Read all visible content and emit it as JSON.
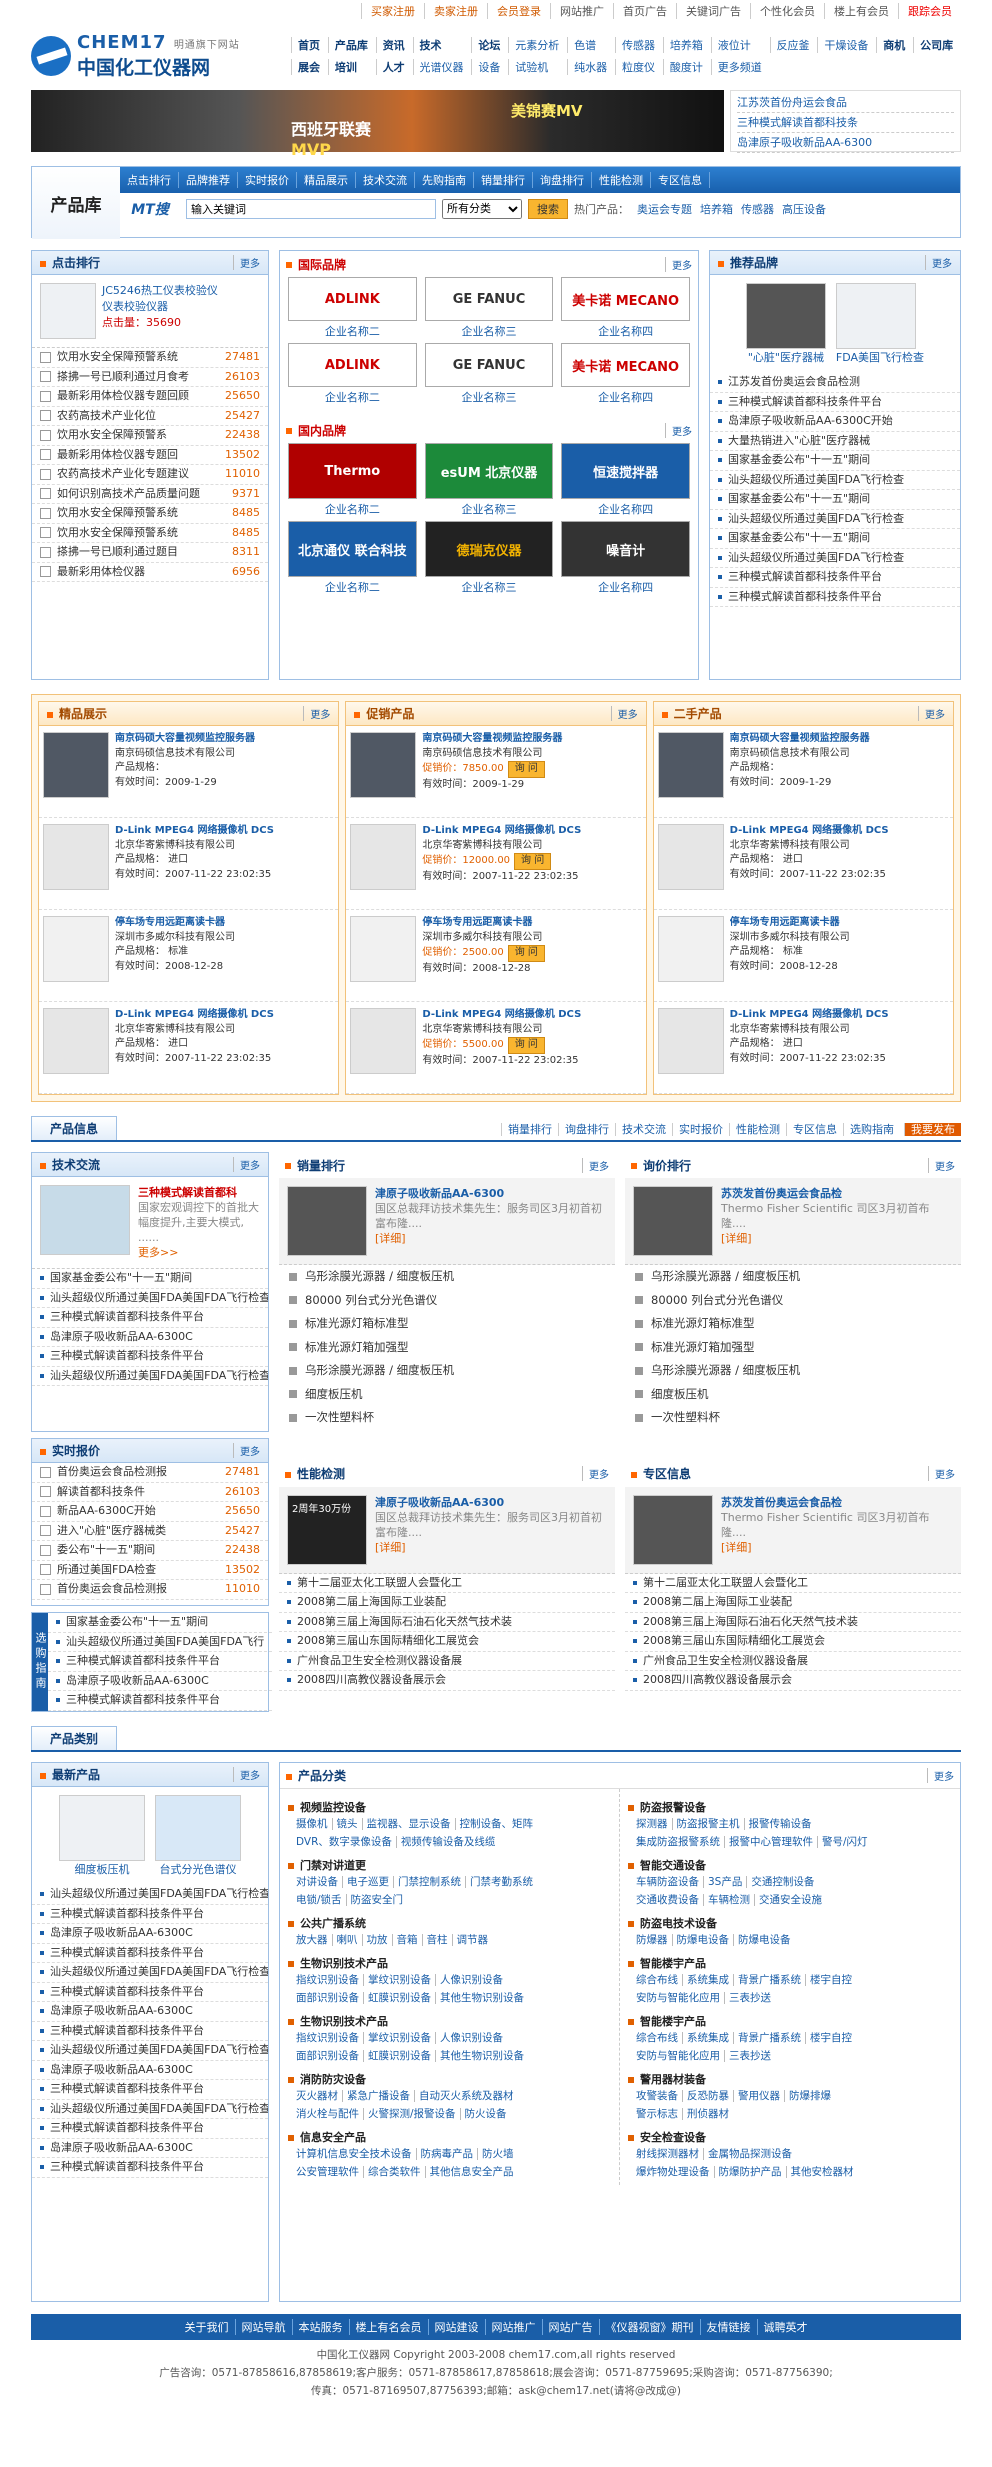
{
  "topbar": {
    "items": [
      "买家注册",
      "卖家注册",
      "会员登录",
      "网站推广",
      "首页广告",
      "关键词广告",
      "个性化会员",
      "楼上有会员",
      "跟踪会员"
    ]
  },
  "logo": {
    "brand": "CHEM17",
    "tag": "明通旗下网站",
    "name": "中国化工仪器网"
  },
  "nav": [
    "首页",
    "产品库",
    "资讯",
    "技术",
    "论坛",
    "元素分析",
    "色谱",
    "传感器",
    "培养箱",
    "液位计",
    "反应釜",
    "干燥设备",
    "商机",
    "公司库",
    "展会",
    "培训",
    "人才",
    "光谱仪器",
    "设备",
    "试验机",
    "纯水器",
    "粒度仪",
    "酸度计",
    "更多频道"
  ],
  "banner": {
    "text1": "西班牙联赛",
    "text1b": "MVP",
    "text2": "美锦赛MV"
  },
  "banner_news": [
    "江苏茨首份舟运会食品",
    "三种模式解读首都科技条",
    "岛津原子吸收新品AA-6300"
  ],
  "prodlib": {
    "title": "产品库",
    "bar": [
      "点击排行",
      "品牌推荐",
      "实时报价",
      "精品展示",
      "技术交流",
      "先购指南",
      "销量排行",
      "询盘排行",
      "性能检测",
      "专区信息"
    ],
    "mt": "MT搜",
    "search_value": "输入关键词",
    "select": "所有分类",
    "btn": "搜索",
    "hot_label": "热门产品：",
    "hot": [
      "奥运会专题",
      "培养箱",
      "传感器",
      "高压设备"
    ]
  },
  "click_rank": {
    "title": "点击排行",
    "more": "更多",
    "top": {
      "name": "JC5246热工仪表校验仪",
      "name2": "仪表校验仪器",
      "clicks": "点击量：35690"
    },
    "items": [
      [
        "饮用水安全保障预警系统",
        "27481"
      ],
      [
        "搽拂一号已顺利通过月食考",
        "26103"
      ],
      [
        "最新彩用体检仪器专题回顾",
        "25650"
      ],
      [
        "农药高技术产业化位",
        "25427"
      ],
      [
        "饮用水安全保障预警系",
        "22438"
      ],
      [
        "最新彩用体检仪器专题回",
        "13502"
      ],
      [
        "农药高技术产业化专题建议",
        "11010"
      ],
      [
        "如何识别高技术产品质量问题",
        "9371"
      ],
      [
        "饮用水安全保障预警系统",
        "8485"
      ],
      [
        "饮用水安全保障预警系统",
        "8485"
      ],
      [
        "搽拂一号已顺利通过题目",
        "8311"
      ],
      [
        "最新彩用体检仪器",
        "6956"
      ]
    ]
  },
  "intl_brands": {
    "title": "国际品牌",
    "more": "更多",
    "items": [
      {
        "logo": "ADLINK",
        "cap": "企业名称二"
      },
      {
        "logo": "GE FANUC",
        "cap": "企业名称三"
      },
      {
        "logo": "美卡诺 MECANO",
        "cap": "企业名称四"
      },
      {
        "logo": "ADLINK",
        "cap": "企业名称二"
      },
      {
        "logo": "GE FANUC",
        "cap": "企业名称三"
      },
      {
        "logo": "美卡诺 MECANO",
        "cap": "企业名称四"
      }
    ]
  },
  "dom_brands": {
    "title": "国内品牌",
    "more": "更多",
    "items": [
      {
        "logo": "Thermo",
        "cap": "企业名称二"
      },
      {
        "logo": "esUM 北京仪器",
        "cap": "企业名称三"
      },
      {
        "logo": "恒速搅拌器",
        "cap": "企业名称四"
      },
      {
        "logo": "北京通仪 联合科技",
        "cap": "企业名称二"
      },
      {
        "logo": "德瑞克仪器",
        "cap": "企业名称三"
      },
      {
        "logo": "噪音计",
        "cap": "企业名称四"
      }
    ]
  },
  "recommend": {
    "title": "推荐品牌",
    "more": "更多",
    "imgs": [
      "\"心脏\"医疗器械",
      "FDA美国飞行检查"
    ],
    "items": [
      "江苏发首份奥运会食品检测",
      "三种模式解读首都科技条件平台",
      "岛津原子吸收新品AA-6300C开始",
      "大量热销进入\"心脏\"医疗器械",
      "国家基金委公布\"十一五\"期间",
      "汕头超级仪所通过美国FDA飞行检查",
      "国家基金委公布\"十一五\"期间",
      "汕头超级仪所通过美国FDA飞行检查",
      "国家基金委公布\"十一五\"期间",
      "汕头超级仪所通过美国FDA飞行检查",
      "三种模式解读首都科技条件平台",
      "三种模式解读首都科技条件平台"
    ]
  },
  "showcase": {
    "title": "精品展示",
    "more": "更多",
    "items": [
      {
        "name": "南京码硕大容量视频监控服务器",
        "co": "南京码硕信息技术有限公司",
        "l2": "产品规格：",
        "time": "有效时间：2009-1-29"
      },
      {
        "name": "D-Link MPEG4 网络摄像机 DCS",
        "co": "北京华寄紫博科技有限公司",
        "l2": "产品规格： 进口",
        "time": "有效时间：2007-11-22 23:02:35"
      },
      {
        "name": "停车场专用远距离读卡器",
        "co": "深圳市多威尔科技有限公司",
        "l2": "产品规格： 标准",
        "time": "有效时间：2008-12-28"
      },
      {
        "name": "D-Link MPEG4 网络摄像机 DCS",
        "co": "北京华寄紫博科技有限公司",
        "l2": "产品规格： 进口",
        "time": "有效时间：2007-11-22 23:02:35"
      }
    ]
  },
  "promo": {
    "title": "促销产品",
    "more": "更多",
    "ask": "询 问",
    "items": [
      {
        "name": "南京码硕大容量视频监控服务器",
        "co": "南京码硕信息技术有限公司",
        "price": "促销价：7850.00",
        "time": "有效时间：2009-1-29"
      },
      {
        "name": "D-Link MPEG4 网络摄像机 DCS",
        "co": "北京华寄紫博科技有限公司",
        "price": "促销价：12000.00",
        "time": "有效时间：2007-11-22 23:02:35"
      },
      {
        "name": "停车场专用远距离读卡器",
        "co": "深圳市多威尔科技有限公司",
        "price": "促销价：2500.00",
        "time": "有效时间：2008-12-28"
      },
      {
        "name": "D-Link MPEG4 网络摄像机 DCS",
        "co": "北京华寄紫博科技有限公司",
        "price": "促销价：5500.00",
        "time": "有效时间：2007-11-22 23:02:35"
      }
    ]
  },
  "second": {
    "title": "二手产品",
    "more": "更多",
    "items": [
      {
        "name": "南京码硕大容量视频监控服务器",
        "co": "南京码硕信息技术有限公司",
        "l2": "产品规格：",
        "time": "有效时间：2009-1-29"
      },
      {
        "name": "D-Link MPEG4 网络摄像机 DCS",
        "co": "北京华寄紫博科技有限公司",
        "l2": "产品规格： 进口",
        "time": "有效时间：2007-11-22 23:02:35"
      },
      {
        "name": "停车场专用远距离读卡器",
        "co": "深圳市多威尔科技有限公司",
        "l2": "产品规格： 标准",
        "time": "有效时间：2008-12-28"
      },
      {
        "name": "D-Link MPEG4 网络摄像机 DCS",
        "co": "北京华寄紫博科技有限公司",
        "l2": "产品规格： 进口",
        "time": "有效时间：2007-11-22 23:02:35"
      }
    ]
  },
  "info_tab": {
    "tab": "产品信息",
    "links": [
      "销量排行",
      "询盘排行",
      "技术交流",
      "实时报价",
      "性能检测",
      "专区信息",
      "选购指南"
    ],
    "pub": "我要发布"
  },
  "tech": {
    "title": "技术交流",
    "more": "更多",
    "feat_title": "三种模式解读首都科",
    "feat_desc": "国家宏观调控下的首批大幅度提升,主要大模式, ......",
    "feat_more": "更多>>",
    "items": [
      "国家基金委公布\"十一五\"期间",
      "汕头超级仪所通过美国FDA美国FDA飞行检查",
      "三种模式解读首都科技条件平台",
      "岛津原子吸收新品AA-6300C",
      "三种模式解读首都科技条件平台",
      "汕头超级仪所通过美国FDA美国FDA飞行检查"
    ]
  },
  "quote": {
    "title": "实时报价",
    "more": "更多",
    "items": [
      [
        "首份奥运会食品检测报",
        "27481"
      ],
      [
        "解读首都科技条件",
        "26103"
      ],
      [
        "新品AA-6300C开始",
        "25650"
      ],
      [
        "进入\"心脏\"医疗器械类",
        "25427"
      ],
      [
        "委公布\"十一五\"期间",
        "22438"
      ],
      [
        "所通过美国FDA检查",
        "13502"
      ],
      [
        "首份奥运会食品检测报",
        "11010"
      ]
    ]
  },
  "guide": {
    "tag": "选购指南",
    "items": [
      "国家基金委公布\"十一五\"期间",
      "汕头超级仪所通过美国FDA美国FDA飞行",
      "三种模式解读首都科技条件平台",
      "岛津原子吸收新品AA-6300C",
      "三种模式解读首都科技条件平台"
    ]
  },
  "sales": {
    "title": "销量排行",
    "more": "更多",
    "feat_title": "津原子吸收新品AA-6300",
    "feat_desc": "国区总裁拜访技术集先生：服务司区3月初首初富布隆....",
    "feat_more": "[详细]",
    "items": [
      "乌形涂膜光源器 / 细度板压机",
      "80000 列台式分光色谱仪",
      "标准光源灯箱标准型",
      "标准光源灯箱加强型",
      "乌形涂膜光源器 / 细度板压机",
      "细度板压机",
      "一次性塑料杯"
    ]
  },
  "inquiry": {
    "title": "询价排行",
    "more": "更多",
    "feat_title": "苏茨发首份奥运会食品检",
    "feat_desc": "Thermo Fisher Scientific 司区3月初首布隆....",
    "feat_more": "[详细]",
    "items": [
      "乌形涂膜光源器 / 细度板压机",
      "80000 列台式分光色谱仪",
      "标准光源灯箱标准型",
      "标准光源灯箱加强型",
      "乌形涂膜光源器 / 细度板压机",
      "细度板压机",
      "一次性塑料杯"
    ]
  },
  "perf": {
    "title": "性能检测",
    "more": "更多",
    "feat_title": "津原子吸收新品AA-6300",
    "feat_desc": "国区总裁拜访技术集先生：服务司区3月初首初富布隆....",
    "feat_more": "[详细]",
    "img_text": "2周年30万份",
    "items": [
      "第十二届亚太化工联盟人会暨化工",
      "2008第二届上海国际工业装配",
      "2008第三届上海国际石油石化天然气技术装",
      "2008第三届山东国际精细化工展览会",
      "广州食品卫生安全检测仪器设备展",
      "2008四川高教仪器设备展示会"
    ]
  },
  "zone": {
    "title": "专区信息",
    "more": "更多",
    "feat_title": "苏茨发首份奥运会食品检",
    "feat_desc": "Thermo Fisher Scientific 司区3月初首布隆....",
    "feat_more": "[详细]",
    "items": [
      "第十二届亚太化工联盟人会暨化工",
      "2008第二届上海国际工业装配",
      "2008第三届上海国际石油石化天然气技术装",
      "2008第三届山东国际精细化工展览会",
      "广州食品卫生安全检测仪器设备展",
      "2008四川高教仪器设备展示会"
    ]
  },
  "cat_tab": {
    "tab": "产品类别"
  },
  "latest": {
    "title": "最新产品",
    "more": "更多",
    "imgs": [
      "细度板压机",
      "台式分光色谱仪"
    ],
    "items": [
      "汕头超级仪所通过美国FDA美国FDA飞行检查",
      "三种模式解读首都科技条件平台",
      "岛津原子吸收新品AA-6300C",
      "三种模式解读首都科技条件平台",
      "汕头超级仪所通过美国FDA美国FDA飞行检查",
      "三种模式解读首都科技条件平台",
      "岛津原子吸收新品AA-6300C",
      "三种模式解读首都科技条件平台",
      "汕头超级仪所通过美国FDA美国FDA飞行检查",
      "岛津原子吸收新品AA-6300C",
      "三种模式解读首都科技条件平台",
      "汕头超级仪所通过美国FDA美国FDA飞行检查",
      "三种模式解读首都科技条件平台",
      "岛津原子吸收新品AA-6300C",
      "三种模式解读首都科技条件平台"
    ]
  },
  "categories": {
    "title": "产品分类",
    "more": "更多",
    "left": [
      {
        "h": "视频监控设备",
        "l": [
          [
            "摄像机",
            "镜头",
            "监视器、显示设备",
            "控制设备、矩阵"
          ],
          [
            "DVR、数字录像设备",
            "视频传输设备及线缆"
          ]
        ]
      },
      {
        "h": "门禁对讲道更",
        "l": [
          [
            "对讲设备",
            "电子巡更",
            "门禁控制系统",
            "门禁考勤系统"
          ],
          [
            "电锁/锁舌",
            "防盗安全门"
          ]
        ]
      },
      {
        "h": "公共广播系统",
        "l": [
          [
            "放大器",
            "喇叭",
            "功放",
            "音箱",
            "音柱",
            "调节器"
          ]
        ]
      },
      {
        "h": "生物识别技术产品",
        "l": [
          [
            "指纹识别设备",
            "掌纹识别设备",
            "人像识别设备"
          ],
          [
            "面部识别设备",
            "虹膜识别设备",
            "其他生物识别设备"
          ]
        ]
      },
      {
        "h": "生物识别技术产品",
        "l": [
          [
            "指纹识别设备",
            "掌纹识别设备",
            "人像识别设备"
          ],
          [
            "面部识别设备",
            "虹膜识别设备",
            "其他生物识别设备"
          ]
        ]
      },
      {
        "h": "消防防灾设备",
        "l": [
          [
            "灭火器材",
            "紧急广播设备",
            "自动灭火系统及器材"
          ],
          [
            "消火栓与配件",
            "火警探测/报警设备",
            "防火设备"
          ]
        ]
      },
      {
        "h": "信息安全产品",
        "l": [
          [
            "计算机信息安全技术设备",
            "防病毒产品",
            "防火墙"
          ],
          [
            "公安管理软件",
            "综合类软件",
            "其他信息安全产品"
          ]
        ]
      }
    ],
    "right": [
      {
        "h": "防盗报警设备",
        "l": [
          [
            "探测器",
            "防盗报警主机",
            "报警传输设备"
          ],
          [
            "集成防盗报警系统",
            "报警中心管理软件",
            "警号/闪灯"
          ]
        ]
      },
      {
        "h": "智能交通设备",
        "l": [
          [
            "车辆防盗设备",
            "3S产品",
            "交通控制设备"
          ],
          [
            "交通收费设备",
            "车辆检测",
            "交通安全设施"
          ]
        ]
      },
      {
        "h": "防盗电技术设备",
        "l": [
          [
            "防爆器",
            "防爆电设备",
            "防爆电设备"
          ]
        ]
      },
      {
        "h": "智能楼宇产品",
        "l": [
          [
            "综合布线",
            "系统集成",
            "背景广播系统",
            "楼宇自控"
          ],
          [
            "安防与智能化应用",
            "三表抄送"
          ]
        ]
      },
      {
        "h": "智能楼宇产品",
        "l": [
          [
            "综合布线",
            "系统集成",
            "背景广播系统",
            "楼宇自控"
          ],
          [
            "安防与智能化应用",
            "三表抄送"
          ]
        ]
      },
      {
        "h": "警用器材装备",
        "l": [
          [
            "攻警装备",
            "反恐防暴",
            "警用仪器",
            "防爆排爆"
          ],
          [
            "警示标志",
            "刑侦器材"
          ]
        ]
      },
      {
        "h": "安全检查设备",
        "l": [
          [
            "射线探测器材",
            "金属物品探测设备"
          ],
          [
            "爆炸物处理设备",
            "防爆防护产品",
            "其他安检器材"
          ]
        ]
      }
    ]
  },
  "footer_nav": [
    "关于我们",
    "网站导航",
    "本站服务",
    "楼上有名会员",
    "网站建设",
    "网站推广",
    "网站广告",
    "《仪器视窗》期刊",
    "友情链接",
    "诚聘英才"
  ],
  "footer": [
    "中国化工仪器网  Copyright  2003-2008  chem17.com,all  rights  reserved",
    "广告咨询：0571-87858616,87858619;客户服务：0571-87858617,87858618;展会咨询：0571-87759695;采购咨询：0571-87756390;",
    "传真：0571-87169507,87756393;邮箱：ask@chem17.net(请将@改成@)"
  ]
}
